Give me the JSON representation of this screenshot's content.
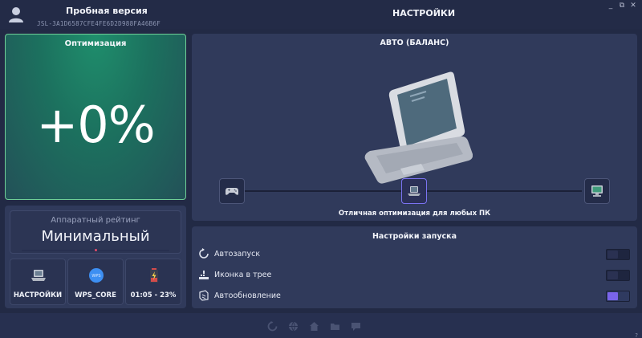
{
  "header": {
    "trial_title": "Пробная версия",
    "license_key": "JSL-3A1D6587CFE4FE6D2D988FA46B6F",
    "page_title": "НАСТРОЙКИ",
    "window_controls": [
      "_",
      "⧉",
      "✕"
    ]
  },
  "optimization": {
    "label": "Оптимизация",
    "value": "+0%"
  },
  "rating": {
    "label": "Аппаратный рейтинг",
    "value": "Минимальный",
    "level": 0.5
  },
  "tiles": [
    {
      "label": "НАСТРОЙКИ",
      "icon": "laptop-icon"
    },
    {
      "label": "WPS_CORE",
      "icon": "wps-icon",
      "badge": "WPS"
    },
    {
      "label": "01:05 - 23%",
      "icon": "battery-icon"
    }
  ],
  "auto_mode": {
    "title": "АВТО (БАЛАНС)",
    "caption": "Отличная оптимизация для любых ПК",
    "modes": [
      {
        "icon": "gamepad-icon",
        "active": false
      },
      {
        "icon": "laptop-icon",
        "active": true
      },
      {
        "icon": "monitor-icon",
        "active": false
      }
    ]
  },
  "launch_settings": {
    "title": "Настройки запуска",
    "rows": [
      {
        "label": "Автозапуск",
        "icon": "refresh-icon",
        "enabled": false
      },
      {
        "label": "Иконка в трее",
        "icon": "tray-icon",
        "enabled": false
      },
      {
        "label": "Автообновление",
        "icon": "update-icon",
        "enabled": true
      }
    ]
  },
  "footer": {
    "icons": [
      "refresh-icon",
      "globe-icon",
      "home-icon",
      "folder-icon",
      "chat-icon"
    ],
    "help": "?"
  },
  "colors": {
    "background": "#222a45",
    "panel": "#303a5b",
    "accent": "#7a64ea",
    "optimization_border": "#6fcf97",
    "rating_marker": "#e24c6a"
  }
}
